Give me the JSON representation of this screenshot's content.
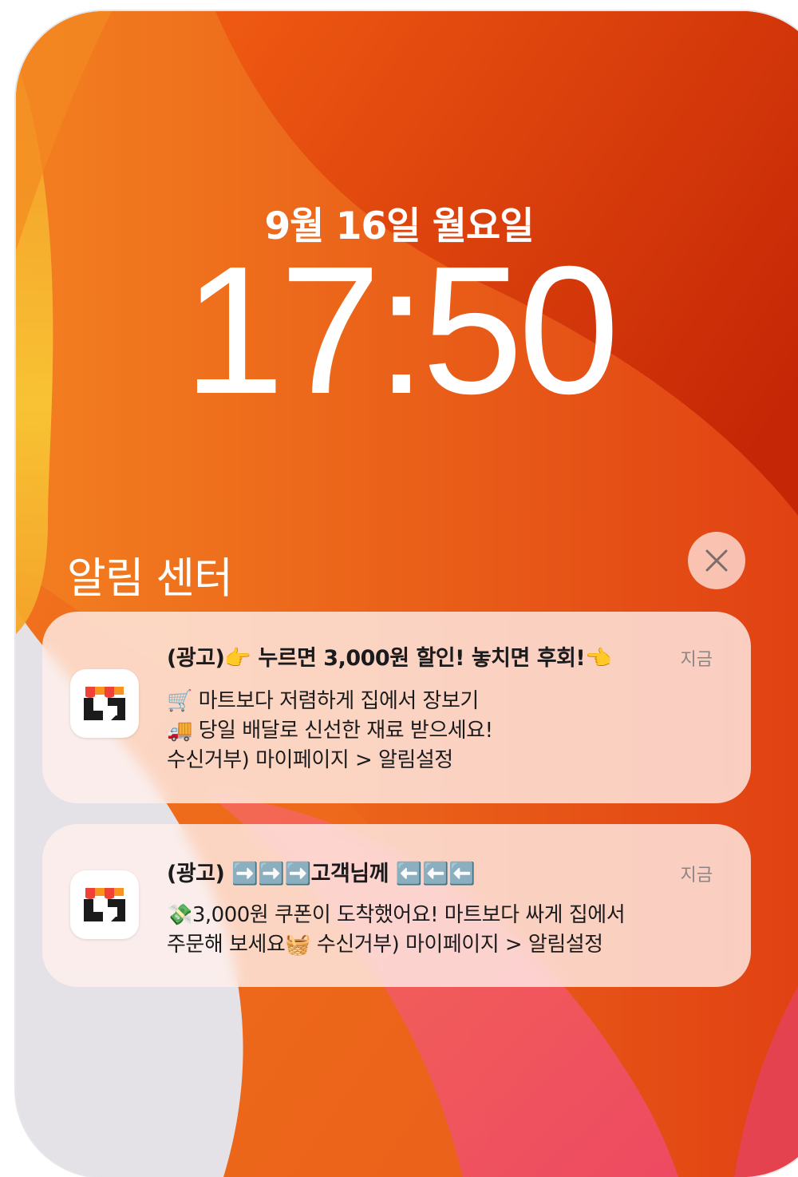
{
  "lockscreen": {
    "date": "9월 16일 월요일",
    "time": "17:50"
  },
  "notification_center": {
    "title": "알림 센터",
    "close_icon": "close-icon"
  },
  "notifications": [
    {
      "app_icon": "mart-app-icon",
      "title": "(광고)👉 누르면 3,000원 할인! 놓치면 후회!👈",
      "time": "지금",
      "body_lines": [
        "🛒 마트보다 저렴하게 집에서 장보기",
        "🚚 당일 배달로 신선한 재료 받으세요!",
        "수신거부) 마이페이지 > 알림설정"
      ]
    },
    {
      "app_icon": "mart-app-icon",
      "title": "(광고) ➡️➡️➡️고객님께 ⬅️⬅️⬅️",
      "time": "지금",
      "body_lines": [
        "💸3,000원 쿠폰이 도착했어요! 마트보다 싸게 집에서",
        "주문해 보세요🧺 수신거부) 마이페이지 > 알림설정"
      ]
    }
  ],
  "colors": {
    "wallpaper_top": "#c92a06",
    "wallpaper_mid": "#f0661c",
    "wallpaper_yellow": "#f6c32e",
    "wallpaper_pink": "#f0566a",
    "icon_orange": "#f7931e",
    "icon_red": "#ef4136",
    "icon_dark": "#1b1b1b"
  }
}
